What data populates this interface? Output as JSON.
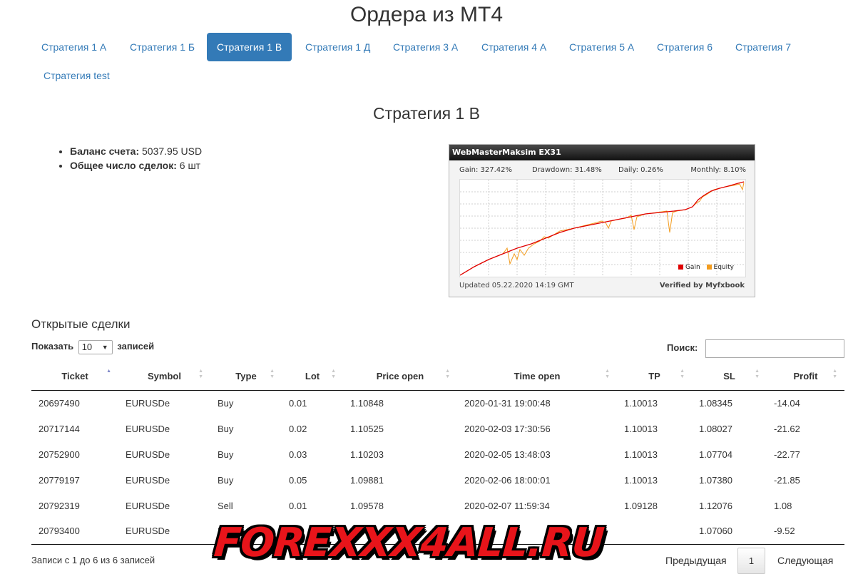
{
  "page": {
    "title": "Ордера из MT4"
  },
  "tabs": [
    {
      "label": "Стратегия 1 А",
      "active": false
    },
    {
      "label": "Стратегия 1 Б",
      "active": false
    },
    {
      "label": "Стратегия 1 В",
      "active": true
    },
    {
      "label": "Стратегия 1 Д",
      "active": false
    },
    {
      "label": "Стратегия 3 А",
      "active": false
    },
    {
      "label": "Стратегия 4 А",
      "active": false
    },
    {
      "label": "Стратегия 5 А",
      "active": false
    },
    {
      "label": "Стратегия 6",
      "active": false
    },
    {
      "label": "Стратегия 7",
      "active": false
    },
    {
      "label": "Стратегия test",
      "active": false
    }
  ],
  "strategy": {
    "title": "Стратегия 1 В",
    "balance_label": "Баланс счета:",
    "balance_value": "5037.95 USD",
    "deals_label": "Общее число сделок:",
    "deals_value": "6 шт"
  },
  "widget": {
    "title": "WebMasterMaksim EX31",
    "gain": "Gain: 327.42%",
    "drawdown": "Drawdown: 31.48%",
    "daily": "Daily: 0.26%",
    "monthly": "Monthly: 8.10%",
    "updated": "Updated 05.22.2020 14:19 GMT",
    "verified": "Verified by Myfxbook",
    "legend_gain": "Gain",
    "legend_equity": "Equity",
    "gain_color": "#e00000",
    "equity_color": "#f39c1e"
  },
  "open_trades": {
    "title": "Открытые сделки",
    "show_label": "Показать",
    "page_size": "10",
    "entries_label": "записей",
    "search_label": "Поиск:",
    "search_value": "",
    "columns": [
      "Ticket",
      "Symbol",
      "Type",
      "Lot",
      "Price open",
      "Time open",
      "TP",
      "SL",
      "Profit"
    ],
    "sort": {
      "column": "Ticket",
      "direction": "asc"
    },
    "rows": [
      [
        "20697490",
        "EURUSDe",
        "Buy",
        "0.01",
        "1.10848",
        "2020-01-31 19:00:48",
        "1.10013",
        "1.08345",
        "-14.04"
      ],
      [
        "20717144",
        "EURUSDe",
        "Buy",
        "0.02",
        "1.10525",
        "2020-02-03 17:30:56",
        "1.10013",
        "1.08027",
        "-21.62"
      ],
      [
        "20752900",
        "EURUSDe",
        "Buy",
        "0.03",
        "1.10203",
        "2020-02-05 13:48:03",
        "1.10013",
        "1.07704",
        "-22.77"
      ],
      [
        "20779197",
        "EURUSDe",
        "Buy",
        "0.05",
        "1.09881",
        "2020-02-06 18:00:01",
        "1.10013",
        "1.07380",
        "-21.85"
      ],
      [
        "20792319",
        "EURUSDe",
        "Sell",
        "0.01",
        "1.09578",
        "2020-02-07 11:59:34",
        "1.09128",
        "1.12076",
        "1.08"
      ],
      [
        "20793400",
        "EURUSDe",
        "B",
        "",
        "",
        "",
        "",
        "1.07060",
        "-9.52"
      ]
    ],
    "info": "Записи с 1 до 6 из 6 записей",
    "prev_label": "Предыдущая",
    "current_page": "1",
    "next_label": "Следующая"
  },
  "watermark": {
    "text": "FOREXXX4ALL.RU"
  }
}
